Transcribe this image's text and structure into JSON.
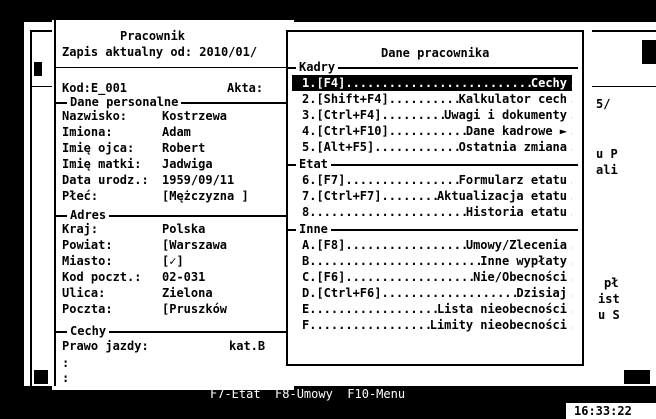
{
  "status_bar": {
    "keys": "F7-Etat  F8-Umowy  F10-Menu",
    "time": "16:33:22"
  },
  "bg_fragments": [
    "5/",
    "u P",
    "ali",
    "pł",
    "ist",
    "u S"
  ],
  "employee": {
    "title": "Pracownik",
    "subtitle": "Zapis aktualny od: 2010/01/",
    "code": "Kod:E_001",
    "akta_label": "Akta:",
    "sections": {
      "personal": "Dane personalne",
      "address": "Adres",
      "features": "Cechy"
    },
    "personal": [
      {
        "label": "Nazwisko:",
        "value": "Kostrzewa"
      },
      {
        "label": "Imiona:",
        "value": "Adam"
      },
      {
        "label": "Imię ojca:",
        "value": "Robert"
      },
      {
        "label": "Imię matki:",
        "value": "Jadwiga"
      },
      {
        "label": "Data urodz.:",
        "value": "1959/09/11"
      },
      {
        "label": "Płeć:",
        "value": "[Mężczyzna ]"
      }
    ],
    "address": [
      {
        "label": "Kraj:",
        "value": "Polska"
      },
      {
        "label": "Powiat:",
        "value": "[Warszawa"
      },
      {
        "label": "Miasto:",
        "value": "[✓]"
      },
      {
        "label": "Kod poczt.:",
        "value": "02-031"
      },
      {
        "label": "Ulica:",
        "value": "Zielona"
      },
      {
        "label": "Poczta:",
        "value": "[Pruszków"
      }
    ],
    "features": [
      {
        "label": "Prawo jazdy:",
        "value": "kat.B"
      },
      {
        "label": ":",
        "value": ""
      },
      {
        "label": ":",
        "value": ""
      }
    ]
  },
  "menu": {
    "title": "Dane pracownika",
    "groups": [
      {
        "label": "Kadry",
        "items": [
          {
            "key": "1.[F4]",
            "label": "Cechy",
            "selected": true
          },
          {
            "key": "2.[Shift+F4]",
            "label": "Kalkulator cech"
          },
          {
            "key": "3.[Ctrl+F4]",
            "label": "Uwagi i dokumenty"
          },
          {
            "key": "4.[Ctrl+F10]",
            "label": "Dane kadrowe ►"
          },
          {
            "key": "5.[Alt+F5]",
            "label": "Ostatnia zmiana"
          }
        ]
      },
      {
        "label": "Etat",
        "items": [
          {
            "key": "6.[F7]",
            "label": "Formularz etatu"
          },
          {
            "key": "7.[Ctrl+F7]",
            "label": "Aktualizacja etatu"
          },
          {
            "key": "8.",
            "label": "Historia etatu"
          }
        ]
      },
      {
        "label": "Inne",
        "items": [
          {
            "key": "A.[F8]",
            "label": "Umowy/Zlecenia"
          },
          {
            "key": "B.",
            "label": "Inne wypłaty"
          },
          {
            "key": "C.[F6]",
            "label": "Nie/Obecności"
          },
          {
            "key": "D.[Ctrl+F6]",
            "label": "Dzisiaj"
          },
          {
            "key": "E.",
            "label": "Lista nieobecności"
          },
          {
            "key": "F.",
            "label": "Limity nieobecności"
          }
        ]
      }
    ]
  }
}
